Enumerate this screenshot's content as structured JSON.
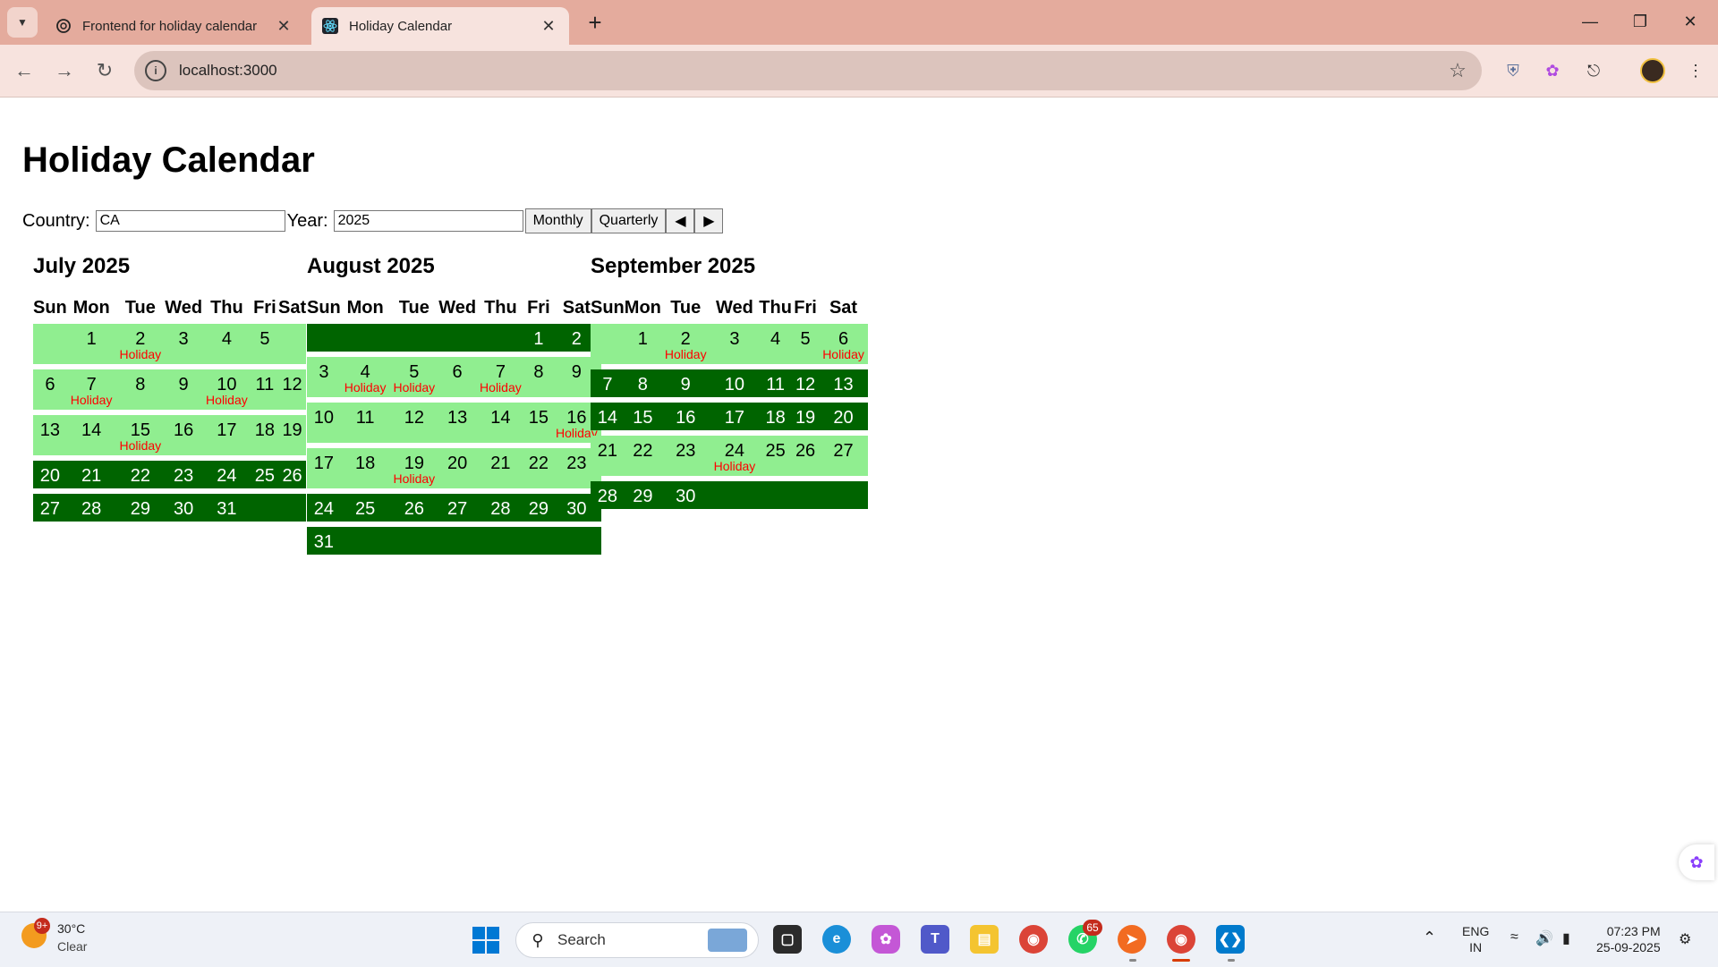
{
  "browser": {
    "tabs": [
      {
        "title": "Frontend for holiday calendar",
        "active": false,
        "icon": "chatgpt-icon"
      },
      {
        "title": "Holiday Calendar",
        "active": true,
        "icon": "react-icon"
      }
    ],
    "url": "localhost:3000"
  },
  "page": {
    "title": "Holiday Calendar",
    "country_label": "Country:",
    "country_value": "CA",
    "year_label": "Year:",
    "year_value": "2025",
    "monthly_label": "Monthly",
    "quarterly_label": "Quarterly",
    "prev_label": "◀",
    "next_label": "▶"
  },
  "weekday_headers": [
    "Sun",
    "Mon",
    "Tue",
    "Wed",
    "Thu",
    "Fri",
    "Sat"
  ],
  "holiday_label": "Holiday",
  "colors": {
    "week_with_holiday": "#90ee90",
    "week_without_holiday": "#006400",
    "holiday_text": "#ff0000"
  },
  "months": [
    {
      "title": "July 2025",
      "weeks": [
        {
          "shade": "light",
          "days": [
            null,
            {
              "d": 1
            },
            {
              "d": 2,
              "holiday": true
            },
            {
              "d": 3
            },
            {
              "d": 4
            },
            {
              "d": 5
            },
            null
          ]
        },
        {
          "shade": "light",
          "days": [
            {
              "d": 6
            },
            {
              "d": 7,
              "holiday": true
            },
            {
              "d": 8
            },
            {
              "d": 9
            },
            {
              "d": 10,
              "holiday": true
            },
            {
              "d": 11
            },
            {
              "d": 12
            }
          ]
        },
        {
          "shade": "light",
          "days": [
            {
              "d": 13
            },
            {
              "d": 14
            },
            {
              "d": 15,
              "holiday": true
            },
            {
              "d": 16
            },
            {
              "d": 17
            },
            {
              "d": 18
            },
            {
              "d": 19
            }
          ]
        },
        {
          "shade": "dark",
          "days": [
            {
              "d": 20
            },
            {
              "d": 21
            },
            {
              "d": 22
            },
            {
              "d": 23
            },
            {
              "d": 24
            },
            {
              "d": 25
            },
            {
              "d": 26
            }
          ]
        },
        {
          "shade": "dark",
          "days": [
            {
              "d": 27
            },
            {
              "d": 28
            },
            {
              "d": 29
            },
            {
              "d": 30
            },
            {
              "d": 31
            },
            null,
            null
          ]
        }
      ]
    },
    {
      "title": "August 2025",
      "weeks": [
        {
          "shade": "dark",
          "days": [
            null,
            null,
            null,
            null,
            null,
            {
              "d": 1
            },
            {
              "d": 2
            }
          ]
        },
        {
          "shade": "light",
          "days": [
            {
              "d": 3
            },
            {
              "d": 4,
              "holiday": true
            },
            {
              "d": 5,
              "holiday": true
            },
            {
              "d": 6
            },
            {
              "d": 7,
              "holiday": true
            },
            {
              "d": 8
            },
            {
              "d": 9
            }
          ]
        },
        {
          "shade": "light",
          "days": [
            {
              "d": 10
            },
            {
              "d": 11
            },
            {
              "d": 12
            },
            {
              "d": 13
            },
            {
              "d": 14
            },
            {
              "d": 15
            },
            {
              "d": 16,
              "holiday": true
            }
          ]
        },
        {
          "shade": "light",
          "days": [
            {
              "d": 17
            },
            {
              "d": 18
            },
            {
              "d": 19,
              "holiday": true
            },
            {
              "d": 20
            },
            {
              "d": 21
            },
            {
              "d": 22
            },
            {
              "d": 23
            }
          ]
        },
        {
          "shade": "dark",
          "days": [
            {
              "d": 24
            },
            {
              "d": 25
            },
            {
              "d": 26
            },
            {
              "d": 27
            },
            {
              "d": 28
            },
            {
              "d": 29
            },
            {
              "d": 30
            }
          ]
        },
        {
          "shade": "dark",
          "days": [
            {
              "d": 31
            },
            null,
            null,
            null,
            null,
            null,
            null
          ]
        }
      ]
    },
    {
      "title": "September 2025",
      "weeks": [
        {
          "shade": "light",
          "days": [
            null,
            {
              "d": 1
            },
            {
              "d": 2,
              "holiday": true
            },
            {
              "d": 3
            },
            {
              "d": 4
            },
            {
              "d": 5
            },
            {
              "d": 6,
              "holiday": true
            }
          ]
        },
        {
          "shade": "dark",
          "days": [
            {
              "d": 7
            },
            {
              "d": 8
            },
            {
              "d": 9
            },
            {
              "d": 10
            },
            {
              "d": 11
            },
            {
              "d": 12
            },
            {
              "d": 13
            }
          ]
        },
        {
          "shade": "dark",
          "days": [
            {
              "d": 14
            },
            {
              "d": 15
            },
            {
              "d": 16
            },
            {
              "d": 17
            },
            {
              "d": 18
            },
            {
              "d": 19
            },
            {
              "d": 20
            }
          ]
        },
        {
          "shade": "light",
          "days": [
            {
              "d": 21
            },
            {
              "d": 22
            },
            {
              "d": 23
            },
            {
              "d": 24,
              "holiday": true
            },
            {
              "d": 25
            },
            {
              "d": 26
            },
            {
              "d": 27
            }
          ]
        },
        {
          "shade": "dark",
          "days": [
            {
              "d": 28
            },
            {
              "d": 29
            },
            {
              "d": 30
            },
            null,
            null,
            null,
            null
          ]
        }
      ]
    }
  ],
  "taskbar": {
    "weather_badge": "9+",
    "weather_temp": "30°C",
    "weather_desc": "Clear",
    "search_placeholder": "Search",
    "whatsapp_badge": "65",
    "lang_top": "ENG",
    "lang_bottom": "IN",
    "time": "07:23 PM",
    "date": "25-09-2025"
  }
}
